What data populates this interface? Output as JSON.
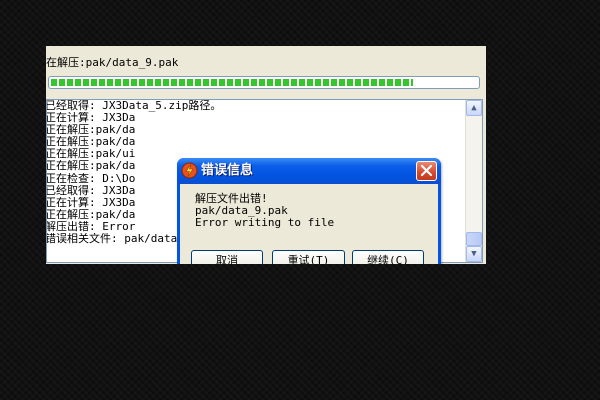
{
  "status_text": "在解压:pak/data_9.pak",
  "progress": 0.85,
  "log_lines": [
    "已经取得: JX3Data_5.zip路径。",
    "正在计算: JX3Da",
    "正在解压:pak/da",
    "正在解压:pak/da",
    "正在解压:pak/ui",
    "正在解压:pak/da",
    "正在检查: D:\\Do",
    "已经取得: JX3Da",
    "正在计算: JX3Da",
    "正在解压:pak/da",
    "解压出错: Error",
    "错误相关文件: pak/data_9.pak"
  ],
  "dialog": {
    "title": "错误信息",
    "message_lines": [
      "解压文件出错!",
      "pak/data_9.pak",
      "Error writing to file"
    ],
    "buttons": {
      "cancel": "取消",
      "retry": "重试(T)",
      "continue": "继续(C)"
    }
  },
  "colors": {
    "title_bar": "#0055e5",
    "close_button": "#d6482a",
    "progress": "#34c62b"
  },
  "icons": {
    "title": "error-bolt-icon",
    "close": "close-icon",
    "scroll_up": "scroll-up-arrow-icon",
    "scroll_down": "scroll-down-arrow-icon"
  }
}
